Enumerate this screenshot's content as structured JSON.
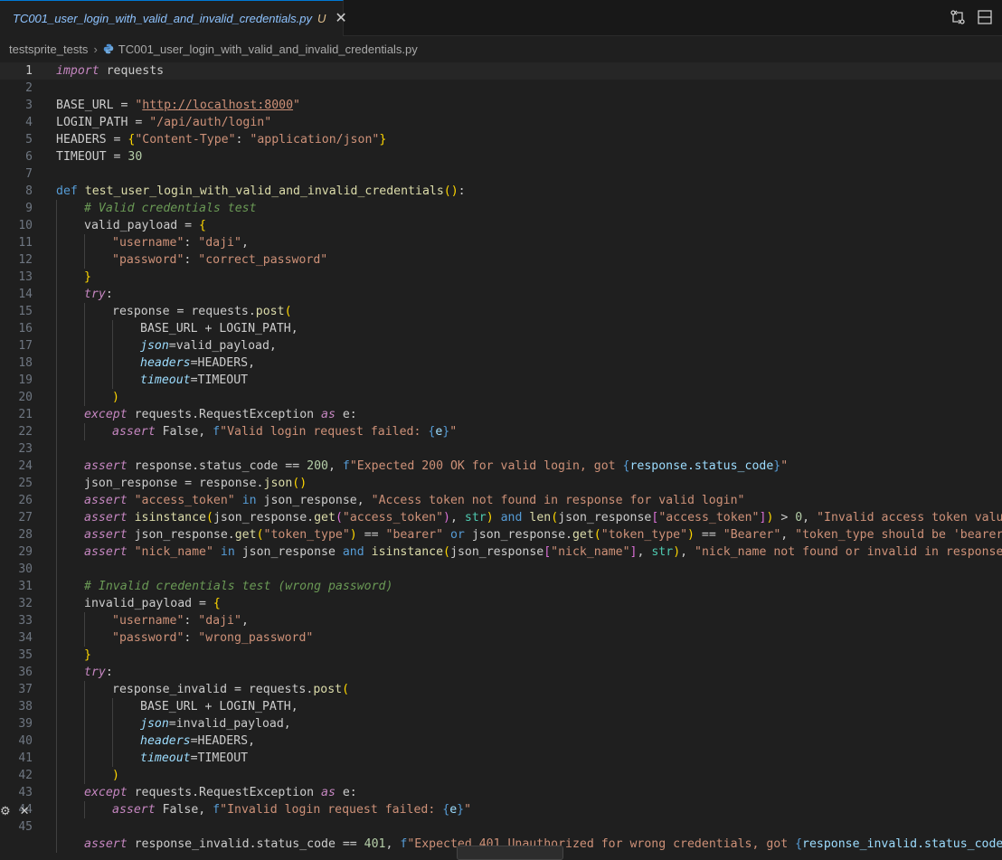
{
  "tab": {
    "title": "TC001_user_login_with_valid_and_invalid_credentials.py",
    "status": "U",
    "close": "✕"
  },
  "breadcrumb": {
    "folder": "testsprite_tests",
    "separator": "›",
    "file": "TC001_user_login_with_valid_and_invalid_credentials.py"
  },
  "editor": {
    "current_line": 1,
    "lines": [
      {
        "n": "1"
      },
      {
        "n": "2"
      },
      {
        "n": "3"
      },
      {
        "n": "4"
      },
      {
        "n": "5"
      },
      {
        "n": "6"
      },
      {
        "n": "7"
      },
      {
        "n": "8"
      },
      {
        "n": "9"
      },
      {
        "n": "10"
      },
      {
        "n": "11"
      },
      {
        "n": "12"
      },
      {
        "n": "13"
      },
      {
        "n": "14"
      },
      {
        "n": "15"
      },
      {
        "n": "16"
      },
      {
        "n": "17"
      },
      {
        "n": "18"
      },
      {
        "n": "19"
      },
      {
        "n": "20"
      },
      {
        "n": "21"
      },
      {
        "n": "22"
      },
      {
        "n": "23"
      },
      {
        "n": "24"
      },
      {
        "n": "25"
      },
      {
        "n": "26"
      },
      {
        "n": "27"
      },
      {
        "n": "28"
      },
      {
        "n": "29"
      },
      {
        "n": "30"
      },
      {
        "n": "31"
      },
      {
        "n": "32"
      },
      {
        "n": "33"
      },
      {
        "n": "34"
      },
      {
        "n": "35"
      },
      {
        "n": "36"
      },
      {
        "n": "37"
      },
      {
        "n": "38"
      },
      {
        "n": "39"
      },
      {
        "n": "40"
      },
      {
        "n": "41"
      },
      {
        "n": "42"
      },
      {
        "n": "43"
      },
      {
        "n": "44"
      },
      {
        "n": "45"
      }
    ],
    "code": {
      "l1a": "import",
      "l1b": " requests",
      "l3a": "BASE_URL = ",
      "l3b": "\"",
      "l3c": "http://localhost:8000",
      "l3d": "\"",
      "l4a": "LOGIN_PATH = ",
      "l4b": "\"/api/auth/login\"",
      "l5a": "HEADERS = ",
      "l5b": "{",
      "l5c": "\"Content-Type\"",
      "l5d": ": ",
      "l5e": "\"application/json\"",
      "l5f": "}",
      "l6a": "TIMEOUT = ",
      "l6b": "30",
      "l8a": "def",
      "l8b": " ",
      "l8c": "test_user_login_with_valid_and_invalid_credentials",
      "l8d": "()",
      "l8e": ":",
      "l9": "# Valid credentials test",
      "l10a": "valid_payload = ",
      "l10b": "{",
      "l11a": "\"username\"",
      "l11b": ": ",
      "l11c": "\"daji\"",
      "l11d": ",",
      "l12a": "\"password\"",
      "l12b": ": ",
      "l12c": "\"correct_password\"",
      "l13": "}",
      "l14a": "try",
      "l14b": ":",
      "l15a": "response = requests.",
      "l15b": "post",
      "l15c": "(",
      "l16": "BASE_URL + LOGIN_PATH,",
      "l17a": "json",
      "l17b": "=valid_payload,",
      "l18a": "headers",
      "l18b": "=HEADERS,",
      "l19a": "timeout",
      "l19b": "=TIMEOUT",
      "l20": ")",
      "l21a": "except",
      "l21b": " requests.RequestException ",
      "l21c": "as",
      "l21d": " e:",
      "l22a": "assert",
      "l22b": " False, ",
      "l22c": "f",
      "l22d": "\"Valid login request failed: ",
      "l22e": "{",
      "l22f": "e",
      "l22g": "}",
      "l22h": "\"",
      "l24a": "assert",
      "l24b": " response.status_code == ",
      "l24c": "200",
      "l24d": ", ",
      "l24e": "f",
      "l24f": "\"Expected 200 OK for valid login, got ",
      "l24g": "{",
      "l24h": "response.status_code",
      "l24i": "}",
      "l24j": "\"",
      "l25a": "json_response = response.",
      "l25b": "json",
      "l25c": "()",
      "l26a": "assert",
      "l26b": " ",
      "l26c": "\"access_token\"",
      "l26d": " in",
      "l26e": " json_response, ",
      "l26f": "\"Access token not found in response for valid login\"",
      "l27a": "assert",
      "l27b": " ",
      "l27c": "isinstance",
      "l27d": "(",
      "l27e": "json_response.",
      "l27f": "get",
      "l27g": "(",
      "l27h": "\"access_token\"",
      "l27i": ")",
      "l27j": ", ",
      "l27k": "str",
      "l27l": ")",
      "l27m": " and ",
      "l27n": "len",
      "l27o": "(",
      "l27p": "json_response",
      "l27q": "[",
      "l27r": "\"access_token\"",
      "l27s": "]",
      "l27t": ")",
      "l27u": " > ",
      "l27v": "0",
      "l27w": ", ",
      "l27x": "\"Invalid access token value\"",
      "l28a": "assert",
      "l28b": " json_response.",
      "l28c": "get",
      "l28d": "(",
      "l28e": "\"token_type\"",
      "l28f": ")",
      "l28g": " == ",
      "l28h": "\"bearer\"",
      "l28i": " or",
      "l28j": " json_response.",
      "l28k": "get",
      "l28l": "(",
      "l28m": "\"token_type\"",
      "l28n": ")",
      "l28o": " == ",
      "l28p": "\"Bearer\"",
      "l28q": ", ",
      "l28r": "\"token_type should be 'bearer'\"",
      "l29a": "assert",
      "l29b": " ",
      "l29c": "\"nick_name\"",
      "l29d": " in",
      "l29e": " json_response ",
      "l29f": "and",
      "l29g": " ",
      "l29h": "isinstance",
      "l29i": "(",
      "l29j": "json_response",
      "l29k": "[",
      "l29l": "\"nick_name\"",
      "l29m": "]",
      "l29n": ", ",
      "l29o": "str",
      "l29p": ")",
      "l29q": ", ",
      "l29r": "\"nick_name not found or invalid in response\"",
      "l31": "# Invalid credentials test (wrong password)",
      "l32a": "invalid_payload = ",
      "l32b": "{",
      "l33a": "\"username\"",
      "l33b": ": ",
      "l33c": "\"daji\"",
      "l33d": ",",
      "l34a": "\"password\"",
      "l34b": ": ",
      "l34c": "\"wrong_password\"",
      "l35": "}",
      "l36a": "try",
      "l36b": ":",
      "l37a": "response_invalid = requests.",
      "l37b": "post",
      "l37c": "(",
      "l38": "BASE_URL + LOGIN_PATH,",
      "l39a": "json",
      "l39b": "=invalid_payload,",
      "l40a": "headers",
      "l40b": "=HEADERS,",
      "l41a": "timeout",
      "l41b": "=TIMEOUT",
      "l42": ")",
      "l43a": "except",
      "l43b": " requests.RequestException ",
      "l43c": "as",
      "l43d": " e:",
      "l44a": "assert",
      "l44b": " False, ",
      "l44c": "f",
      "l44d": "\"Invalid login request failed: ",
      "l44e": "{",
      "l44f": "e",
      "l44g": "}",
      "l44h": "\"",
      "l46a": "assert",
      "l46b": " response_invalid.status_code == ",
      "l46c": "401",
      "l46d": ", ",
      "l46e": "f",
      "l46f": "\"Expected ",
      "l46g": "401 Unauthorized",
      "l46h": " for wrong credentials, got ",
      "l46i": "{",
      "l46j": "response_invalid.status_code",
      "l46k": "}",
      "l46l": "\""
    }
  },
  "side_widget": {
    "gear": "⚙",
    "close": "✕"
  },
  "colors": {
    "background": "#1f1f1f",
    "tab_title": "#8ec3ff",
    "keyword": "#c586c0",
    "string": "#ce9178",
    "function": "#dcdcaa",
    "number": "#b5cea8",
    "comment": "#6a9955"
  }
}
